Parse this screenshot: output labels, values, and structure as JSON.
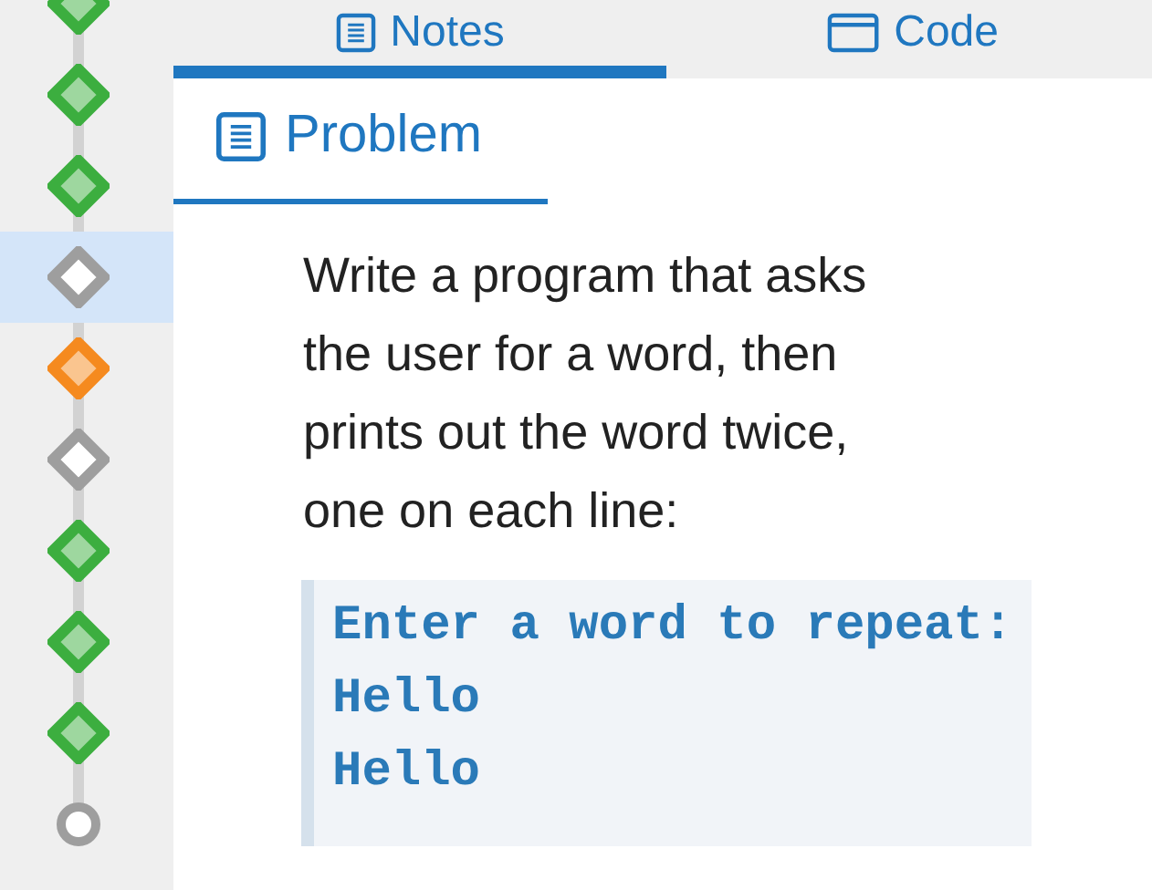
{
  "steps": [
    {
      "kind": "diamond",
      "color": "#3cae3f",
      "selected": false
    },
    {
      "kind": "diamond",
      "color": "#3cae3f",
      "selected": false
    },
    {
      "kind": "diamond",
      "color": "#3cae3f",
      "selected": false
    },
    {
      "kind": "hollow_diamond",
      "color": "#9e9e9e",
      "selected": true
    },
    {
      "kind": "diamond",
      "color": "#f58a1f",
      "selected": false
    },
    {
      "kind": "hollow_diamond",
      "color": "#9e9e9e",
      "selected": false
    },
    {
      "kind": "diamond",
      "color": "#3cae3f",
      "selected": false
    },
    {
      "kind": "diamond",
      "color": "#3cae3f",
      "selected": false
    },
    {
      "kind": "diamond",
      "color": "#3cae3f",
      "selected": false
    },
    {
      "kind": "circle",
      "color": "#9e9e9e",
      "selected": false
    }
  ],
  "top_tabs": [
    {
      "label": "Notes",
      "kind": "notes",
      "selected": true
    },
    {
      "label": "Code",
      "kind": "code",
      "selected": false
    }
  ],
  "problem_tab": {
    "label": "Problem",
    "selected": true
  },
  "problem_text": "Write a program that asks the user for a word, then prints out the word twice, one on each line:",
  "code_block": [
    "Enter a word to repeat:",
    "Hello",
    "Hello"
  ]
}
